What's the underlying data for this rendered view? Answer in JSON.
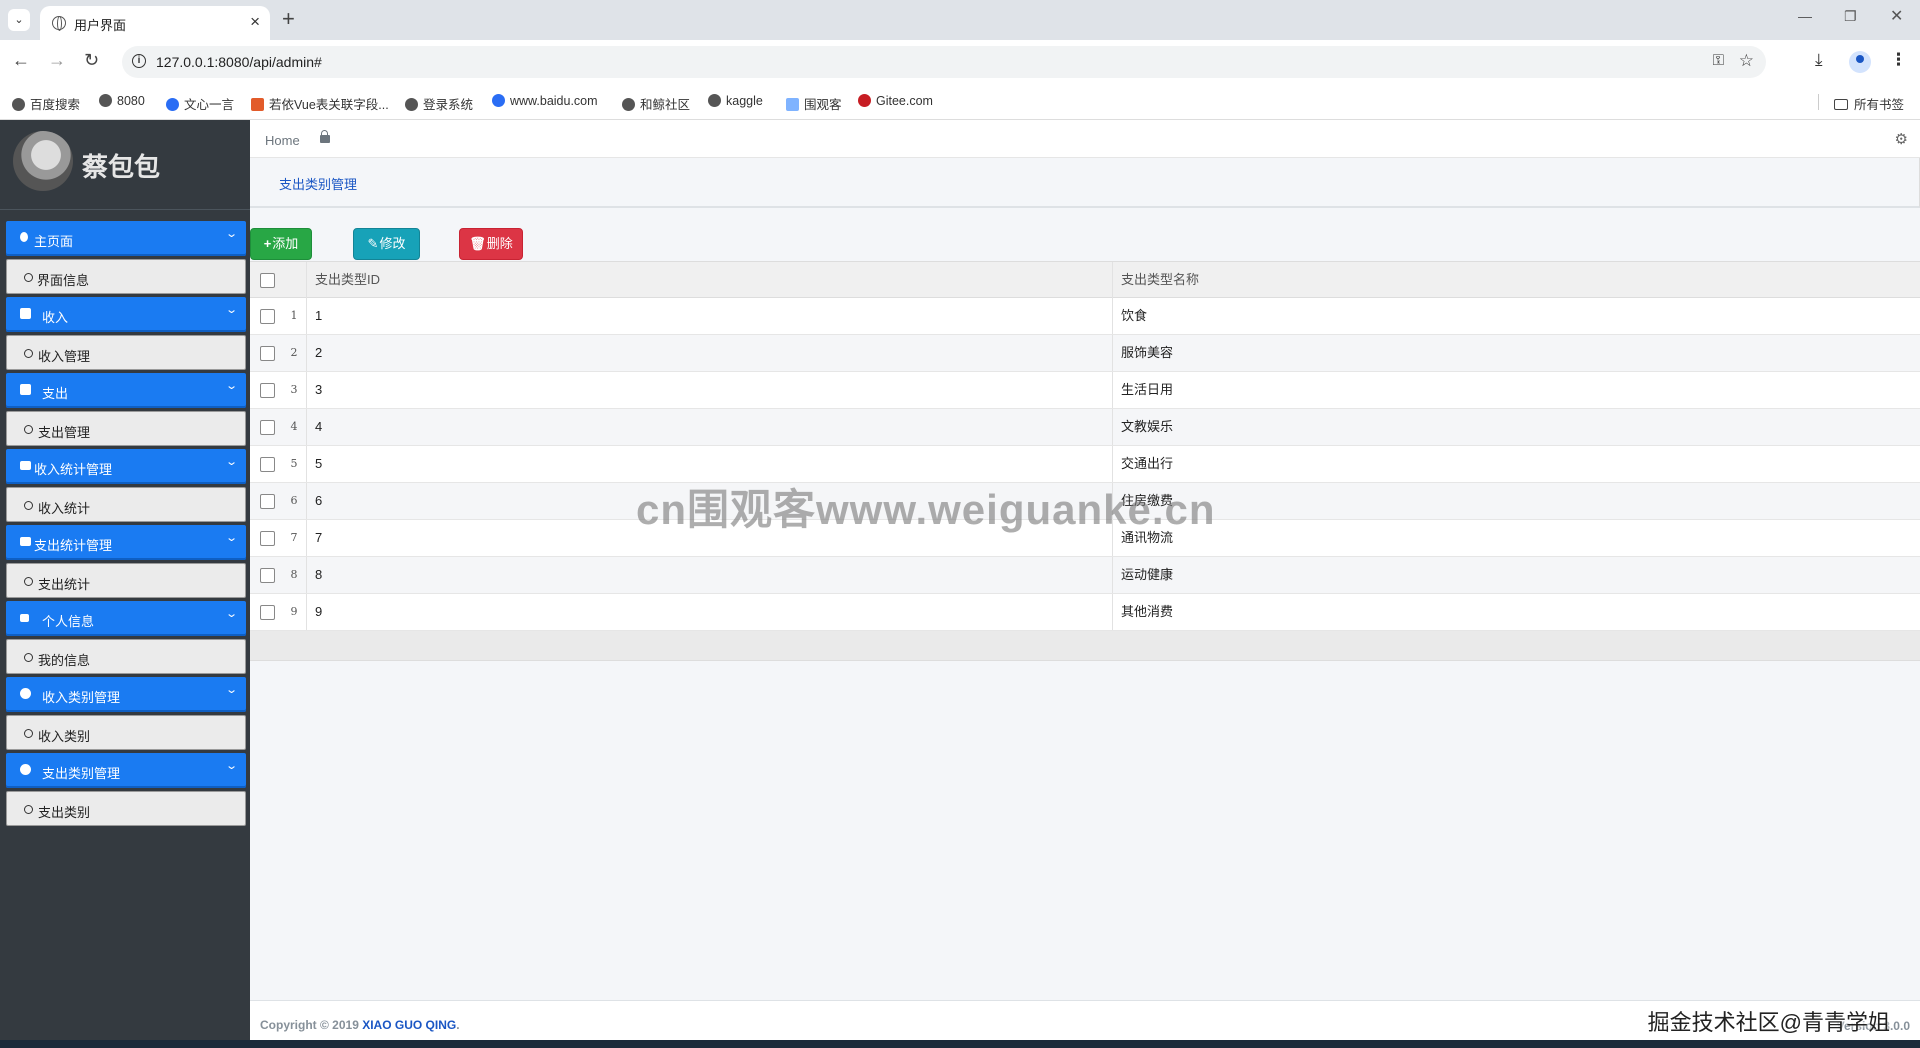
{
  "browser": {
    "tab_title": "用户界面",
    "url": "127.0.0.1:8080/api/admin#",
    "bookmarks": [
      "百度搜索",
      "8080",
      "文心一言",
      "若依Vue表关联字段...",
      "登录系统",
      "www.baidu.com",
      "和鲸社区",
      "kaggle",
      "围观客",
      "Gitee.com"
    ],
    "bookmarks_folder": "所有书签"
  },
  "sidebar": {
    "user_name": "蔡包包",
    "menu": [
      {
        "header": "主页面",
        "icon": "home-icon",
        "item": "界面信息"
      },
      {
        "header": "收入",
        "icon": "plus-square-icon",
        "item": "收入管理"
      },
      {
        "header": "支出",
        "icon": "minus-square-icon",
        "item": "支出管理"
      },
      {
        "header": "收入统计管理",
        "icon": "bar-chart-icon",
        "item": "收入统计"
      },
      {
        "header": "支出统计管理",
        "icon": "bar-chart-icon",
        "item": "支出统计"
      },
      {
        "header": "个人信息",
        "icon": "lock-icon",
        "item": "我的信息"
      },
      {
        "header": "收入类别管理",
        "icon": "circle-icon",
        "item": "收入类别"
      },
      {
        "header": "支出类别管理",
        "icon": "circle-icon",
        "item": "支出类别"
      }
    ]
  },
  "topnav": {
    "home": "Home"
  },
  "breadcrumb": "支出类别管理",
  "toolbar": {
    "add": "添加",
    "edit": "修改",
    "delete": "删除"
  },
  "grid": {
    "columns": [
      "支出类型ID",
      "支出类型名称"
    ],
    "rows": [
      {
        "n": "1",
        "id": "1",
        "name": "饮食"
      },
      {
        "n": "2",
        "id": "2",
        "name": "服饰美容"
      },
      {
        "n": "3",
        "id": "3",
        "name": "生活日用"
      },
      {
        "n": "4",
        "id": "4",
        "name": "文教娱乐"
      },
      {
        "n": "5",
        "id": "5",
        "name": "交通出行"
      },
      {
        "n": "6",
        "id": "6",
        "name": "住房缴费"
      },
      {
        "n": "7",
        "id": "7",
        "name": "通讯物流"
      },
      {
        "n": "8",
        "id": "8",
        "name": "运动健康"
      },
      {
        "n": "9",
        "id": "9",
        "name": "其他消费"
      }
    ]
  },
  "watermark": "cn围观客www.weiguanke.cn",
  "footer": {
    "copyright_prefix": "Copyright © 2019 ",
    "copyright_link": "XIAO GUO QING",
    "copyright_suffix": ".",
    "version": "Version 3.0.0",
    "overlay_watermark": "掘金技术社区@青青学姐"
  },
  "colors": {
    "sidebar_bg": "#343a40",
    "menu_header": "#1a7bf2",
    "add": "#28a745",
    "edit": "#17a2b8",
    "delete": "#dc3545"
  }
}
